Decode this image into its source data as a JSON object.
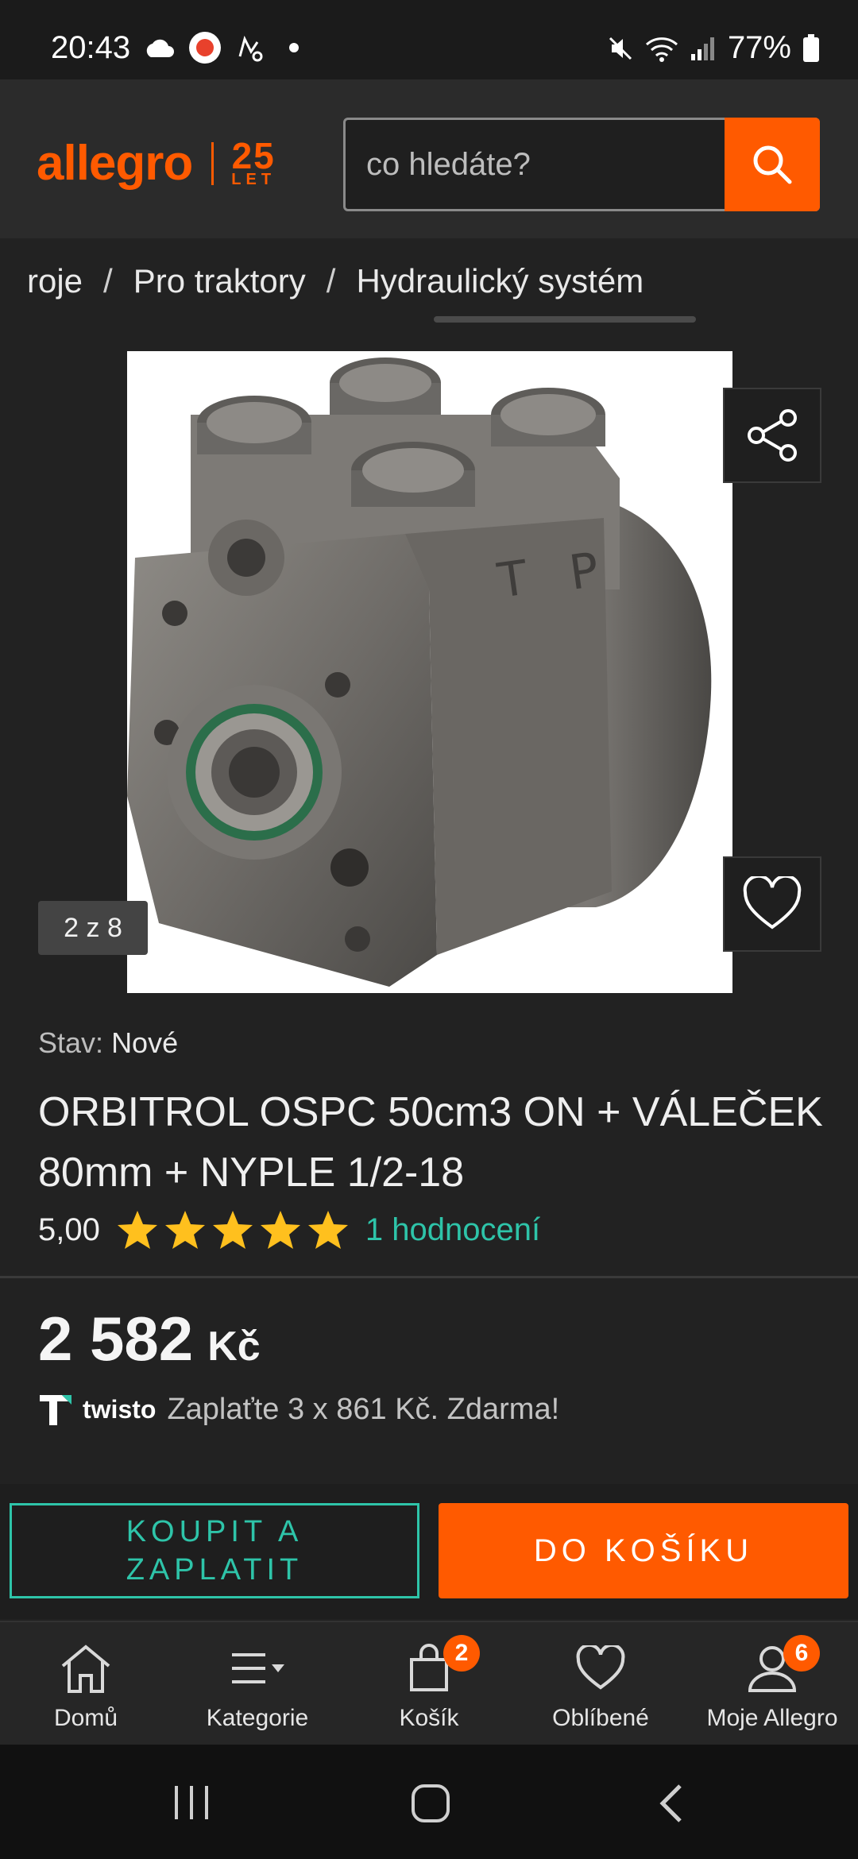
{
  "status_bar": {
    "time": "20:43",
    "battery": "77%",
    "icons": [
      "cloud-icon",
      "notification-app-icon",
      "gesture-app-icon",
      "dot-icon",
      "mute-icon",
      "wifi-icon",
      "signal-icon",
      "battery-icon"
    ]
  },
  "header": {
    "logo_text": "allegro",
    "anniversary_number": "25",
    "anniversary_word": "LET",
    "search_placeholder": "co hledáte?",
    "search_icon": "search-icon"
  },
  "breadcrumb": {
    "items": [
      "roje",
      "Pro traktory",
      "Hydraulický systém"
    ],
    "separator": "/"
  },
  "gallery": {
    "counter": "2 z 8",
    "share_icon": "share-icon",
    "favorite_icon": "heart-icon"
  },
  "product": {
    "condition_label": "Stav:",
    "condition_value": "Nové",
    "title": "ORBITROL OSPC 50cm3 ON + VÁLEČEK 80mm + NYPLE 1/2-18",
    "rating_value": "5,00",
    "rating_stars": 5,
    "rating_count": "1 hodnocení",
    "price_amount": "2 582",
    "price_currency": "Kč",
    "installment_brand": "twisto",
    "installment_text": "Zaplaťte 3 x 861 Kč. Zdarma!"
  },
  "actions": {
    "buy_now": "KOUPIT A ZAPLATIT",
    "add_to_cart": "DO KOŠÍKU"
  },
  "bottom_nav": {
    "items": [
      {
        "label": "Domů",
        "icon": "home-icon"
      },
      {
        "label": "Kategorie",
        "icon": "menu-icon"
      },
      {
        "label": "Košík",
        "icon": "cart-icon",
        "badge": "2"
      },
      {
        "label": "Oblíbené",
        "icon": "heart-icon"
      },
      {
        "label": "Moje Allegro",
        "icon": "user-icon",
        "badge": "6"
      }
    ]
  },
  "colors": {
    "accent": "#ff5a00",
    "teal": "#2ec4a9",
    "star": "#ffc01e",
    "background": "#222222"
  }
}
